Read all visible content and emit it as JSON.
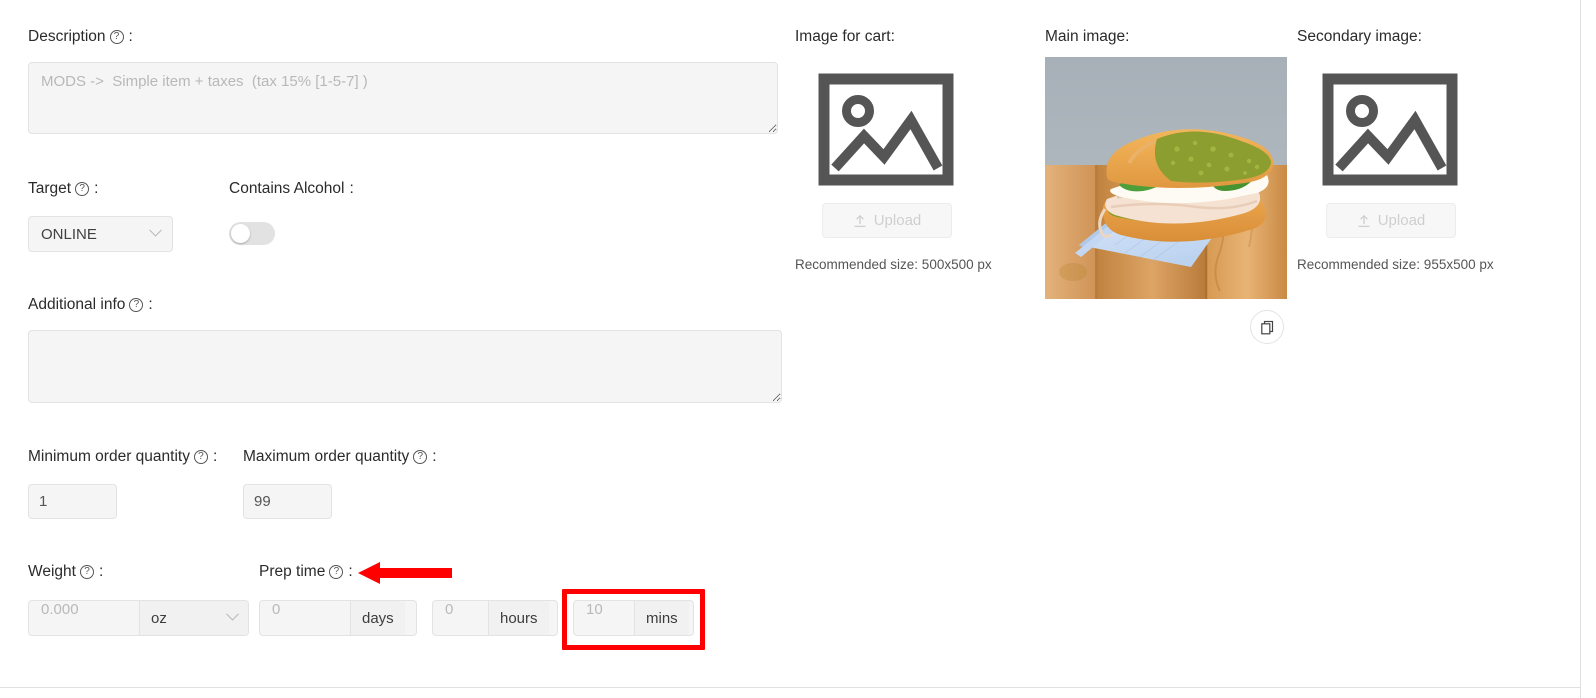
{
  "form": {
    "description": {
      "label": "Description",
      "placeholder": "MODS ->  Simple item + taxes  (tax 15% [1-5-7] )",
      "value": ""
    },
    "target": {
      "label": "Target",
      "value": "ONLINE",
      "options": [
        "ONLINE"
      ]
    },
    "contains_alcohol": {
      "label": "Contains Alcohol",
      "state": "off"
    },
    "additional_info": {
      "label": "Additional info",
      "value": "",
      "placeholder": ""
    },
    "minimum_order_quantity": {
      "label": "Minimum order quantity",
      "value": "1"
    },
    "maximum_order_quantity": {
      "label": "Maximum order quantity",
      "value": "99"
    },
    "weight": {
      "label": "Weight",
      "placeholder": "0.000",
      "value": "",
      "unit": "oz"
    },
    "prep_time": {
      "label": "Prep time",
      "days": {
        "placeholder": "0",
        "value": "",
        "unit": "days"
      },
      "hours": {
        "placeholder": "0",
        "value": "",
        "unit": "hours"
      },
      "mins": {
        "placeholder": "10",
        "value": "",
        "unit": "mins"
      }
    },
    "colon": ":"
  },
  "images": {
    "cart": {
      "title": "Image for cart:",
      "upload_label": "Upload",
      "recommended": "Recommended size: 500x500 px",
      "has_image": false
    },
    "main": {
      "title": "Main image:",
      "has_image": true,
      "alt": "Turkey pesto sandwich on a blue napkin over a wooden board"
    },
    "secondary": {
      "title": "Secondary image:",
      "upload_label": "Upload",
      "recommended": "Recommended size: 955x500 px",
      "has_image": false
    }
  },
  "annotations": {
    "highlight_color": "#ff0000",
    "highlight_target": "prep-time-mins-field",
    "arrow_target": "prep-time-label"
  },
  "colors": {
    "field_bg": "#f5f5f5",
    "field_border": "#e3e3e3",
    "text": "#2b2b2b",
    "placeholder": "#b9b9b9",
    "icon_gray": "#555555",
    "annotation_red": "#ff0000"
  }
}
